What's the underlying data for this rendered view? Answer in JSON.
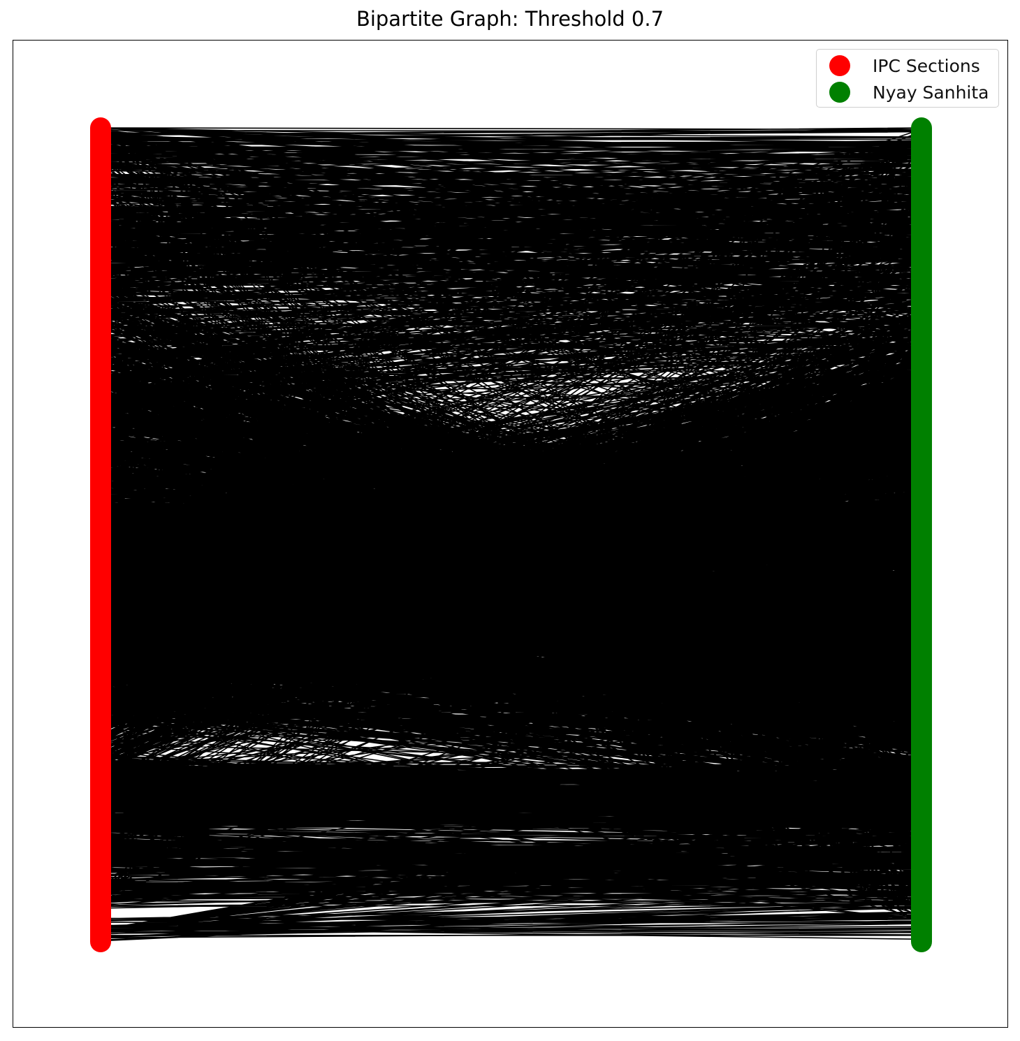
{
  "title": "Bipartite Graph: Threshold 0.7",
  "legend": {
    "items": [
      {
        "label": "IPC Sections",
        "color": "#ff0000"
      },
      {
        "label": "Nyay Sanhita",
        "color": "#008000"
      }
    ]
  },
  "graph": {
    "edge_color": "#000000",
    "left_partition": {
      "name": "IPC Sections",
      "color": "#ff0000"
    },
    "right_partition": {
      "name": "Nyay Sanhita",
      "color": "#008000"
    }
  }
}
